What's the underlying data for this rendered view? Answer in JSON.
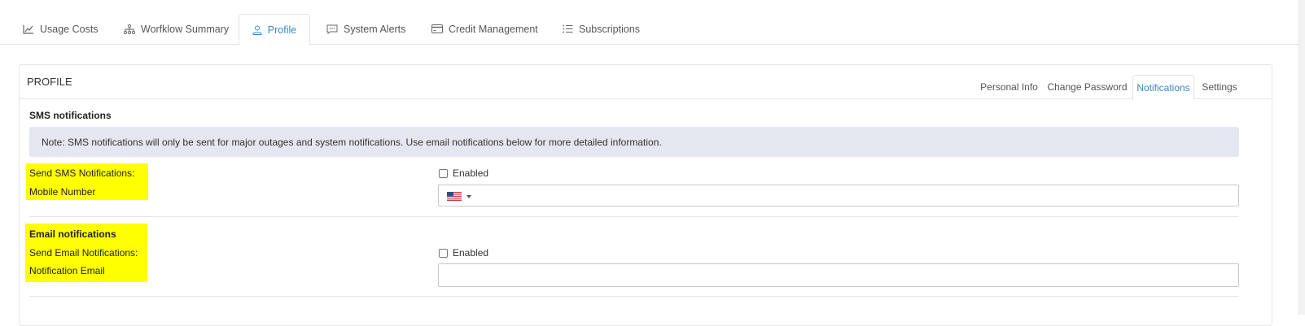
{
  "top_tabs": [
    {
      "label": "Usage Costs",
      "icon": "chart-line-icon"
    },
    {
      "label": "Worfklow Summary",
      "icon": "sitemap-icon"
    },
    {
      "label": "Profile",
      "icon": "user-icon",
      "active": true
    },
    {
      "label": "System Alerts",
      "icon": "comment-dots-icon"
    },
    {
      "label": "Credit Management",
      "icon": "credit-card-icon"
    },
    {
      "label": "Subscriptions",
      "icon": "list-icon"
    }
  ],
  "panel": {
    "title": "PROFILE",
    "tabs": [
      {
        "label": "Personal Info"
      },
      {
        "label": "Change Password"
      },
      {
        "label": "Notifications",
        "active": true
      },
      {
        "label": "Settings"
      }
    ]
  },
  "sms": {
    "section_title": "SMS notifications",
    "note": "Note: SMS notifications will only be sent for major outages and system notifications. Use email notifications below for more detailed information.",
    "send_label": "Send SMS Notifications:",
    "mobile_label": "Mobile Number",
    "enabled_label": "Enabled",
    "enabled": false,
    "mobile_value": "",
    "country_flag": "us-flag-icon"
  },
  "email": {
    "section_title": "Email notifications",
    "send_label": "Send Email Notifications:",
    "email_label": "Notification Email",
    "enabled_label": "Enabled",
    "enabled": false,
    "email_value": ""
  },
  "colors": {
    "accent": "#3a88c8",
    "highlight": "#ffff00",
    "note_bg": "#e4e7ef"
  }
}
